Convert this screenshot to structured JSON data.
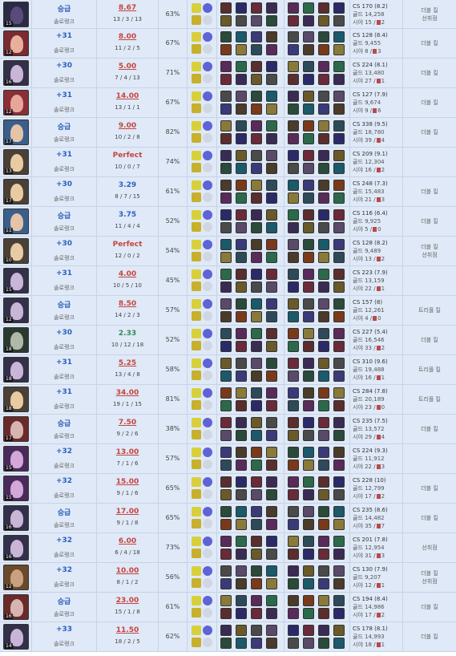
{
  "icons": {
    "ward": "ward-icon",
    "spell": "summoner-spell-icon",
    "item": "item-icon",
    "champion": "champion-portrait"
  },
  "colors": {
    "row_bg": "#dfe9f7",
    "lp_blue": "#2c5fbd",
    "kda_red": "#c6443e",
    "kda_green": "#2e8b57",
    "ward_red": "#b94a4a"
  },
  "rows": [
    {
      "level": "15",
      "lp": "승급",
      "lp_sub": "솔로랭크",
      "kda": "8.67",
      "kda_style": "red",
      "score": "13 / 3 / 13",
      "kp": "63%",
      "cs": "CS 170 (8.2)",
      "gold": "골드 14,258",
      "vision": "시야 15 /",
      "wards": "2",
      "badge": [
        "더블 킬",
        "선취점"
      ],
      "face": "#5a4a7a",
      "bg": "#2b2a44"
    },
    {
      "level": "12",
      "lp": "+31",
      "lp_sub": "솔로랭크",
      "kda": "8.00",
      "kda_style": "red",
      "score": "11 / 2 / 5",
      "kp": "67%",
      "cs": "CS 128 (8.4)",
      "gold": "골드 9,455",
      "vision": "시야 8 /",
      "wards": "3",
      "badge": [
        "더블 킬"
      ],
      "face": "#e8b09a",
      "bg": "#7a2a30"
    },
    {
      "level": "16",
      "lp": "+30",
      "lp_sub": "솔로랭크",
      "kda": "5.00",
      "kda_style": "red",
      "score": "7 / 4 / 13",
      "kp": "71%",
      "cs": "CS 224 (8.1)",
      "gold": "골드 13,480",
      "vision": "시야 27 /",
      "wards": "1",
      "badge": [
        "더블 킬"
      ],
      "face": "#c9b5d6",
      "bg": "#33304a"
    },
    {
      "level": "12",
      "lp": "+31",
      "lp_sub": "솔로랭크",
      "kda": "14.00",
      "kda_style": "red",
      "score": "13 / 1 / 1",
      "kp": "67%",
      "cs": "CS 127 (7.9)",
      "gold": "골드 9,674",
      "vision": "시야 9 /",
      "wards": "6",
      "badge": [
        "더블 킬"
      ],
      "face": "#e8a59a",
      "bg": "#8a2e38"
    },
    {
      "level": "17",
      "lp": "승급",
      "lp_sub": "솔로랭크",
      "kda": "9.00",
      "kda_style": "red",
      "score": "10 / 2 / 8",
      "kp": "82%",
      "cs": "CS 338 (9.5)",
      "gold": "골드 18,780",
      "vision": "시야 39 /",
      "wards": "4",
      "badge": [
        "더블 킬"
      ],
      "face": "#e4c3a8",
      "bg": "#3a5f8a"
    },
    {
      "level": "13",
      "lp": "+31",
      "lp_sub": "솔로랭크",
      "kda": "Perfect",
      "kda_style": "perfect",
      "score": "10 / 0 / 7",
      "kp": "74%",
      "cs": "CS 209 (9.1)",
      "gold": "골드 12,304",
      "vision": "시야 16 /",
      "wards": "2",
      "badge": [],
      "face": "#e9cba3",
      "bg": "#4a4036"
    },
    {
      "level": "17",
      "lp": "+30",
      "lp_sub": "솔로랭크",
      "kda": "3.29",
      "kda_style": "blue",
      "score": "8 / 7 / 15",
      "kp": "61%",
      "cs": "CS 248 (7.3)",
      "gold": "골드 15,483",
      "vision": "시야 21 /",
      "wards": "3",
      "badge": [
        "더블 킬"
      ],
      "face": "#e9cba3",
      "bg": "#4a4036"
    },
    {
      "level": "11",
      "lp": "승급",
      "lp_sub": "솔로랭크",
      "kda": "3.75",
      "kda_style": "blue",
      "score": "11 / 4 / 4",
      "kp": "52%",
      "cs": "CS 116 (6.4)",
      "gold": "골드 9,925",
      "vision": "시야 5 /",
      "wards": "0",
      "badge": [
        "더블 킬"
      ],
      "face": "#e4c3a8",
      "bg": "#3a5f8a"
    },
    {
      "level": "10",
      "lp": "+30",
      "lp_sub": "솔로랭크",
      "kda": "Perfect",
      "kda_style": "perfect",
      "score": "12 / 0 / 2",
      "kp": "54%",
      "cs": "CS 128 (8.2)",
      "gold": "골드 9,489",
      "vision": "시야 13 /",
      "wards": "2",
      "badge": [
        "더블 킬",
        "선취점"
      ],
      "face": "#e9cba3",
      "bg": "#4a4036"
    },
    {
      "level": "15",
      "lp": "+31",
      "lp_sub": "솔로랭크",
      "kda": "4.00",
      "kda_style": "red",
      "score": "10 / 5 / 10",
      "kp": "45%",
      "cs": "CS 223 (7.9)",
      "gold": "골드 13,159",
      "vision": "시야 22 /",
      "wards": "1",
      "badge": [],
      "face": "#c9b5d6",
      "bg": "#33304a"
    },
    {
      "level": "12",
      "lp": "승급",
      "lp_sub": "솔로랭크",
      "kda": "8.50",
      "kda_style": "red",
      "score": "14 / 2 / 3",
      "kp": "57%",
      "cs": "CS 157 (8)",
      "gold": "골드 12,261",
      "vision": "시야 4 /",
      "wards": "0",
      "badge": [
        "트리플 킬"
      ],
      "face": "#c9b5d6",
      "bg": "#33304a"
    },
    {
      "level": "18",
      "lp": "+30",
      "lp_sub": "솔로랭크",
      "kda": "2.33",
      "kda_style": "green",
      "score": "10 / 12 / 18",
      "kp": "52%",
      "cs": "CS 227 (5.4)",
      "gold": "골드 16,546",
      "vision": "시야 33 /",
      "wards": "2",
      "badge": [
        "더블 킬"
      ],
      "face": "#b0b8a8",
      "bg": "#2a3a30"
    },
    {
      "level": "18",
      "lp": "+31",
      "lp_sub": "솔로랭크",
      "kda": "5.25",
      "kda_style": "red",
      "score": "13 / 4 / 8",
      "kp": "58%",
      "cs": "CS 310 (9.6)",
      "gold": "골드 19,488",
      "vision": "시야 16 /",
      "wards": "1",
      "badge": [
        "트리플 킬"
      ],
      "face": "#c9b5d6",
      "bg": "#33304a"
    },
    {
      "level": "18",
      "lp": "+31",
      "lp_sub": "솔로랭크",
      "kda": "34.00",
      "kda_style": "red",
      "score": "19 / 1 / 15",
      "kp": "81%",
      "cs": "CS 284 (7.8)",
      "gold": "골드 20,189",
      "vision": "시야 23 /",
      "wards": "0",
      "badge": [
        "트리플 킬"
      ],
      "face": "#e9cba3",
      "bg": "#4a4036"
    },
    {
      "level": "17",
      "lp": "승급",
      "lp_sub": "솔로랭크",
      "kda": "7.50",
      "kda_style": "red",
      "score": "9 / 2 / 6",
      "kp": "38%",
      "cs": "CS 235 (7.5)",
      "gold": "골드 13,572",
      "vision": "시야 29 /",
      "wards": "4",
      "badge": [
        "더블 킬"
      ],
      "face": "#d8b4b0",
      "bg": "#6a2a2a"
    },
    {
      "level": "15",
      "lp": "+32",
      "lp_sub": "솔로랭크",
      "kda": "13.00",
      "kda_style": "red",
      "score": "7 / 1 / 6",
      "kp": "57%",
      "cs": "CS 224 (9.3)",
      "gold": "골드 11,912",
      "vision": "시야 22 /",
      "wards": "3",
      "badge": [],
      "face": "#d3a8d8",
      "bg": "#4a2a5a"
    },
    {
      "level": "15",
      "lp": "+32",
      "lp_sub": "솔로랭크",
      "kda": "15.00",
      "kda_style": "red",
      "score": "9 / 1 / 6",
      "kp": "65%",
      "cs": "CS 228 (10)",
      "gold": "골드 12,799",
      "vision": "시야 17 /",
      "wards": "2",
      "badge": [
        "더블 킬"
      ],
      "face": "#d3a8d8",
      "bg": "#4a2a5a"
    },
    {
      "level": "16",
      "lp": "승급",
      "lp_sub": "솔로랭크",
      "kda": "17.00",
      "kda_style": "red",
      "score": "9 / 1 / 8",
      "kp": "65%",
      "cs": "CS 235 (8.6)",
      "gold": "골드 14,482",
      "vision": "시야 35 /",
      "wards": "7",
      "badge": [
        "더블 킬"
      ],
      "face": "#c9b5d6",
      "bg": "#33304a"
    },
    {
      "level": "16",
      "lp": "+32",
      "lp_sub": "솔로랭크",
      "kda": "6.00",
      "kda_style": "red",
      "score": "6 / 4 / 18",
      "kp": "73%",
      "cs": "CS 201 (7.8)",
      "gold": "골드 12,954",
      "vision": "시야 31 /",
      "wards": "3",
      "badge": [
        "선취점"
      ],
      "face": "#c9b5d6",
      "bg": "#33304a"
    },
    {
      "level": "12",
      "lp": "+32",
      "lp_sub": "솔로랭크",
      "kda": "10.00",
      "kda_style": "red",
      "score": "8 / 1 / 2",
      "kp": "56%",
      "cs": "CS 130 (7.9)",
      "gold": "골드 9,207",
      "vision": "시야 12 /",
      "wards": "1",
      "badge": [
        "더블 킬",
        "선취점"
      ],
      "face": "#c9a080",
      "bg": "#6a4a2a"
    },
    {
      "level": "16",
      "lp": "승급",
      "lp_sub": "솔로랭크",
      "kda": "23.00",
      "kda_style": "red",
      "score": "15 / 1 / 8",
      "kp": "61%",
      "cs": "CS 194 (8.4)",
      "gold": "골드 14,986",
      "vision": "시야 17 /",
      "wards": "2",
      "badge": [
        "더블 킬"
      ],
      "face": "#d8b4b0",
      "bg": "#6a2a2a"
    },
    {
      "level": "14",
      "lp": "+33",
      "lp_sub": "솔로랭크",
      "kda": "11.50",
      "kda_style": "red",
      "score": "18 / 2 / 5",
      "kp": "62%",
      "cs": "CS 178 (8.1)",
      "gold": "골드 14,993",
      "vision": "시야 18 /",
      "wards": "1",
      "badge": [
        "더블 킬"
      ],
      "face": "#c9b5d6",
      "bg": "#33304a"
    }
  ]
}
